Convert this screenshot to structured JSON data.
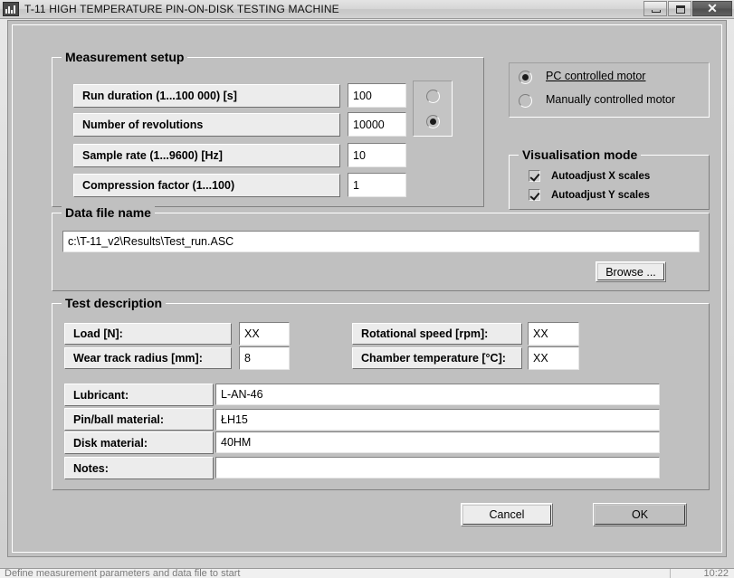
{
  "window": {
    "title": "T-11 HIGH TEMPERATURE PIN-ON-DISK TESTING MACHINE",
    "icon": "bar-chart-icon",
    "minimize_label": "",
    "maximize_label": "",
    "close_label": "✕"
  },
  "measurement_setup": {
    "title": "Measurement setup",
    "rows": [
      {
        "label": "Run duration (1...100 000) [s]",
        "value": "100"
      },
      {
        "label": "Number of revolutions",
        "value": "10000"
      },
      {
        "label": "Sample rate (1...9600) [Hz]",
        "value": "10"
      },
      {
        "label": "Compression factor (1...100)",
        "value": "1"
      }
    ],
    "mode_radios": [
      {
        "name": "duration-mode-radio",
        "selected": false
      },
      {
        "name": "revolutions-mode-radio",
        "selected": true
      }
    ]
  },
  "motor_control": {
    "options": [
      {
        "label": "PC controlled motor",
        "selected": true,
        "focused": true
      },
      {
        "label": "Manually controlled motor",
        "selected": false,
        "focused": false
      }
    ]
  },
  "visualisation_mode": {
    "title": "Visualisation mode",
    "checkboxes": [
      {
        "label": "Autoadjust X scales",
        "checked": true
      },
      {
        "label": "Autoadjust Y scales",
        "checked": true
      }
    ]
  },
  "data_file": {
    "title": "Data file name",
    "path": "c:\\T-11_v2\\Results\\Test_run.ASC",
    "browse_label": "Browse ..."
  },
  "test_description": {
    "title": "Test description",
    "left_fields": [
      {
        "label": "Load [N]:",
        "value": "XX"
      },
      {
        "label": "Wear track radius [mm]:",
        "value": "8"
      }
    ],
    "right_fields": [
      {
        "label": "Rotational speed [rpm]:",
        "value": "XX"
      },
      {
        "label": "Chamber temperature [°C]:",
        "value": "XX"
      }
    ],
    "wide_fields": [
      {
        "label": "Lubricant:",
        "value": "L-AN-46"
      },
      {
        "label": "Pin/ball material:",
        "value": "ŁH15"
      },
      {
        "label": "Disk material:",
        "value": "40HM"
      },
      {
        "label": "Notes:",
        "value": ""
      }
    ]
  },
  "actions": {
    "cancel_label": "Cancel",
    "ok_label": "OK"
  },
  "statusbar": {
    "text": "Define measurement parameters and data file to start",
    "clock": "10:22"
  },
  "colors": {
    "face": "#c0c0c0",
    "panel": "#ececec",
    "field": "#ffffff",
    "text": "#000000",
    "default_button": "#bfbfbf"
  }
}
